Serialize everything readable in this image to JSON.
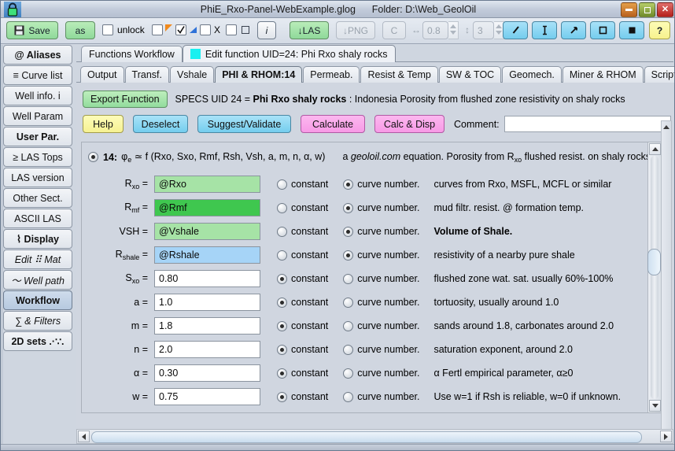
{
  "window": {
    "title": "PhiE_Rxo-Panel-WebExample.glog      Folder: D:\\Web_GeolOil",
    "lock_icon": "padlock-icon",
    "buttons": {
      "minimize": "–",
      "maximize": "□",
      "close": "✕"
    }
  },
  "toolbar": {
    "save_label": "Save",
    "as_label": "as",
    "unlock_label": "unlock",
    "x_label": "X",
    "info_label": "i",
    "las_label": "↓LAS",
    "png_label": "↓PNG",
    "c_label": "C",
    "width_icon": "↔",
    "width_value": "0.8",
    "height_icon": "↕",
    "height_value": "3",
    "tool_line": "line-tool-icon",
    "tool_vertical": "vertical-tool-icon",
    "tool_arrow": "arrow-tool-icon",
    "tool_rect_outline": "rect-outline-tool-icon",
    "tool_rect_filled": "rect-filled-tool-icon",
    "help_label": "?"
  },
  "sidebar": {
    "items": [
      {
        "label": "@ Aliases",
        "style": "bold",
        "active": false
      },
      {
        "label": "≡ Curve list",
        "style": "normal",
        "active": false
      },
      {
        "label": "Well info.  i",
        "style": "normal",
        "active": false
      },
      {
        "label": "Well Param",
        "style": "normal",
        "active": false
      },
      {
        "label": "User Par.",
        "style": "bold",
        "active": false
      },
      {
        "label": "≥ LAS Tops",
        "style": "normal",
        "active": false
      },
      {
        "label": "LAS version",
        "style": "normal",
        "active": false
      },
      {
        "label": "Other Sect.",
        "style": "normal",
        "active": false
      },
      {
        "label": "ASCII LAS",
        "style": "normal",
        "active": false
      },
      {
        "label": "⌇ Display",
        "style": "bold",
        "active": false
      },
      {
        "label": "Edit ⠿ Mat",
        "style": "italic",
        "active": false
      },
      {
        "label": "〜 Well path",
        "style": "italic",
        "active": false
      },
      {
        "label": "Workflow",
        "style": "bold",
        "active": true
      },
      {
        "label": "∑ & Filters",
        "style": "italic",
        "active": false
      },
      {
        "label": "2D sets .·∵.",
        "style": "normal",
        "active": false
      }
    ]
  },
  "outer_tabs": [
    {
      "label": "Functions Workflow",
      "active": false,
      "swatch": null
    },
    {
      "label": "Edit function UID=24: Phi Rxo shaly rocks",
      "active": true,
      "swatch": "#19f0f0"
    }
  ],
  "inner_tabs": [
    {
      "label": "Output",
      "active": false
    },
    {
      "label": "Transf.",
      "active": false
    },
    {
      "label": "Vshale",
      "active": false
    },
    {
      "label": "PHI & RHOM:14",
      "active": true
    },
    {
      "label": "Permeab.",
      "active": false
    },
    {
      "label": "Resist & Temp",
      "active": false
    },
    {
      "label": "SW & TOC",
      "active": false
    },
    {
      "label": "Geomech.",
      "active": false
    },
    {
      "label": "Miner & RHOM",
      "active": false
    },
    {
      "label": "Scripting",
      "active": false
    }
  ],
  "header": {
    "export_label": "Export Function",
    "specs_prefix": "SPECS UID 24 = ",
    "specs_name": "Phi Rxo shaly rocks",
    "specs_suffix": " : Indonesia Porosity from flushed zone resistivity on shaly rocks"
  },
  "action_buttons": [
    {
      "label": "Help",
      "color": "yellow"
    },
    {
      "label": "Deselect",
      "color": "cyan"
    },
    {
      "label": "Suggest/Validate",
      "color": "cyan"
    },
    {
      "label": "Calculate",
      "color": "pink"
    },
    {
      "label": "Calc & Disp",
      "color": "pink"
    }
  ],
  "comment": {
    "label": "Comment:",
    "value": "",
    "placeholder": ""
  },
  "equation": {
    "selected": true,
    "number": "14:",
    "formula_lhs": "φ",
    "formula_sub": "e",
    "formula_rhs": "≃ f (Rxo, Sxo, Rmf, Rsh, Vsh, a, m, n, α, w)",
    "desc_pre": "a ",
    "desc_em": "geoloil.com",
    "desc_post": " equation. Porosity from R",
    "desc_sub": "xo",
    "desc_end": " flushed resist. on shaly rocks"
  },
  "parameters": [
    {
      "label": "R",
      "label_sub": "xo",
      "label_eq": " =",
      "value": "@Rxo",
      "field_color": "#a6e3a6",
      "mode": "curve",
      "constant_label": "constant",
      "curve_label": "curve number.",
      "description": "curves from Rxo, MSFL, MCFL or similar",
      "desc_bold": ""
    },
    {
      "label": "R",
      "label_sub": "mf",
      "label_eq": " =",
      "value": "@Rmf",
      "field_color": "#3fc74f",
      "mode": "curve",
      "constant_label": "constant",
      "curve_label": "curve number.",
      "description": "mud filtr. resist. @ formation temp.",
      "desc_bold": ""
    },
    {
      "label": "VSH",
      "label_sub": "",
      "label_eq": " =",
      "value": "@Vshale",
      "field_color": "#a6e3a6",
      "mode": "curve",
      "constant_label": "constant",
      "curve_label": "curve number.",
      "description": "Volume of Shale.",
      "desc_bold": "bold"
    },
    {
      "label": "R",
      "label_sub": "shale",
      "label_eq": " =",
      "value": "@Rshale",
      "field_color": "#a6d4f7",
      "mode": "curve",
      "constant_label": "constant",
      "curve_label": "curve number.",
      "description": "resistivity of a nearby pure shale",
      "desc_bold": ""
    },
    {
      "label": "S",
      "label_sub": "xo",
      "label_eq": " =",
      "value": "0.80",
      "field_color": "#ffffff",
      "mode": "constant",
      "constant_label": "constant",
      "curve_label": "curve number.",
      "description": "flushed zone wat. sat. usually 60%-100%",
      "desc_bold": ""
    },
    {
      "label": "a",
      "label_sub": "",
      "label_eq": " =",
      "value": "1.0",
      "field_color": "#ffffff",
      "mode": "constant",
      "constant_label": "constant",
      "curve_label": "curve number.",
      "description": "tortuosity, usually around 1.0",
      "desc_bold": ""
    },
    {
      "label": "m",
      "label_sub": "",
      "label_eq": " =",
      "value": "1.8",
      "field_color": "#ffffff",
      "mode": "constant",
      "constant_label": "constant",
      "curve_label": "curve number.",
      "description": "sands around 1.8, carbonates around 2.0",
      "desc_bold": ""
    },
    {
      "label": "n",
      "label_sub": "",
      "label_eq": " =",
      "value": "2.0",
      "field_color": "#ffffff",
      "mode": "constant",
      "constant_label": "constant",
      "curve_label": "curve number.",
      "description": "saturation exponent, around 2.0",
      "desc_bold": ""
    },
    {
      "label": "α",
      "label_sub": "",
      "label_eq": " =",
      "value": "0.30",
      "field_color": "#ffffff",
      "mode": "constant",
      "constant_label": "constant",
      "curve_label": "curve number.",
      "description": "α Fertl empirical parameter, α≥0",
      "desc_bold": ""
    },
    {
      "label": "w",
      "label_sub": "",
      "label_eq": " =",
      "value": "0.75",
      "field_color": "#ffffff",
      "mode": "constant",
      "constant_label": "constant",
      "curve_label": "curve number.",
      "description": "Use w=1 if Rsh is reliable, w=0 if unknown.",
      "desc_bold": ""
    }
  ],
  "colors": {
    "accent_cyan": "#19f0f0",
    "green_button": "#93dc9d",
    "pink_button": "#f79ae6",
    "cyan_button": "#74cdee",
    "yellow_button": "#f6f192",
    "panel_bg": "#d0d6e0"
  }
}
